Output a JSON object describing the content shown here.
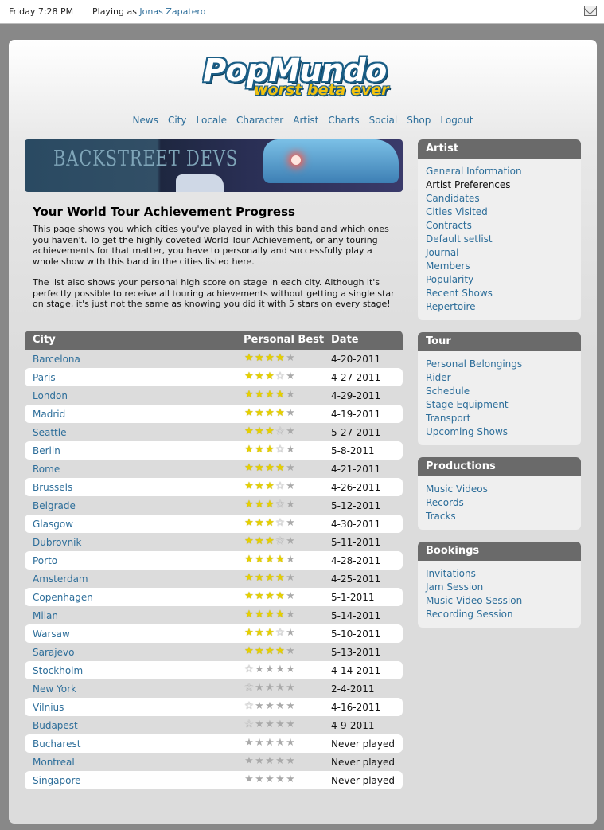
{
  "topbar": {
    "clock": "Friday 7:28 PM",
    "playing_prefix": "Playing as",
    "player_name": "Jonas Zapatero",
    "mail_icon": "envelope-icon"
  },
  "logo": {
    "main": "PopMundo",
    "sub": "worst beta ever"
  },
  "nav": [
    "News",
    "City",
    "Locale",
    "Character",
    "Artist",
    "Charts",
    "Social",
    "Shop",
    "Logout"
  ],
  "banner": {
    "band_name": "BACKSTREET DEVS"
  },
  "page": {
    "title": "Your World Tour Achievement Progress",
    "para1": "This page shows you which cities you've played in with this band and which ones you haven't. To get the highly coveted World Tour Achievement, or any touring achievements for that matter, you have to personally and successfully play a whole show with this band in the cities listed here.",
    "para2": "The list also shows your personal high score on stage in each city. Although it's perfectly possible to receive all touring achievements without getting a single star on stage, it's just not the same as knowing you did it with 5 stars on every stage!"
  },
  "table": {
    "headers": {
      "city": "City",
      "best": "Personal Best",
      "date": "Date"
    },
    "rows": [
      {
        "city": "Barcelona",
        "stars": 4,
        "date": "4-20-2011"
      },
      {
        "city": "Paris",
        "stars": 3,
        "date": "4-27-2011"
      },
      {
        "city": "London",
        "stars": 4,
        "date": "4-29-2011"
      },
      {
        "city": "Madrid",
        "stars": 4,
        "date": "4-19-2011"
      },
      {
        "city": "Seattle",
        "stars": 3,
        "date": "5-27-2011"
      },
      {
        "city": "Berlin",
        "stars": 3,
        "date": "5-8-2011"
      },
      {
        "city": "Rome",
        "stars": 4,
        "date": "4-21-2011"
      },
      {
        "city": "Brussels",
        "stars": 3,
        "date": "4-26-2011"
      },
      {
        "city": "Belgrade",
        "stars": 3,
        "date": "5-12-2011"
      },
      {
        "city": "Glasgow",
        "stars": 3,
        "date": "4-30-2011"
      },
      {
        "city": "Dubrovnik",
        "stars": 3,
        "date": "5-11-2011"
      },
      {
        "city": "Porto",
        "stars": 4,
        "date": "4-28-2011"
      },
      {
        "city": "Amsterdam",
        "stars": 4,
        "date": "4-25-2011"
      },
      {
        "city": "Copenhagen",
        "stars": 4,
        "date": "5-1-2011"
      },
      {
        "city": "Milan",
        "stars": 4,
        "date": "5-14-2011"
      },
      {
        "city": "Warsaw",
        "stars": 3,
        "date": "5-10-2011"
      },
      {
        "city": "Sarajevo",
        "stars": 4,
        "date": "5-13-2011"
      },
      {
        "city": "Stockholm",
        "stars": 0.5,
        "date": "4-14-2011"
      },
      {
        "city": "New York",
        "stars": 0.5,
        "date": "2-4-2011"
      },
      {
        "city": "Vilnius",
        "stars": 0.5,
        "date": "4-16-2011"
      },
      {
        "city": "Budapest",
        "stars": 0.5,
        "date": "4-9-2011"
      },
      {
        "city": "Bucharest",
        "stars": 0,
        "date": "Never played"
      },
      {
        "city": "Montreal",
        "stars": 0,
        "date": "Never played"
      },
      {
        "city": "Singapore",
        "stars": 0,
        "date": "Never played"
      }
    ]
  },
  "sidebar": [
    {
      "title": "Artist",
      "items": [
        "General Information",
        "Artist Preferences",
        "Candidates",
        "Cities Visited",
        "Contracts",
        "Default setlist",
        "Journal",
        "Members",
        "Popularity",
        "Recent Shows",
        "Repertoire"
      ],
      "plain": [
        1
      ]
    },
    {
      "title": "Tour",
      "items": [
        "Personal Belongings",
        "Rider",
        "Schedule",
        "Stage Equipment",
        "Transport",
        "Upcoming Shows"
      ],
      "plain": []
    },
    {
      "title": "Productions",
      "items": [
        "Music Videos",
        "Records",
        "Tracks"
      ],
      "plain": []
    },
    {
      "title": "Bookings",
      "items": [
        "Invitations",
        "Jam Session",
        "Music Video Session",
        "Recording Session"
      ],
      "plain": []
    }
  ],
  "colors": {
    "link": "#2d6e9a",
    "header_bg": "#6a6a6a",
    "star": "#e6d000"
  }
}
